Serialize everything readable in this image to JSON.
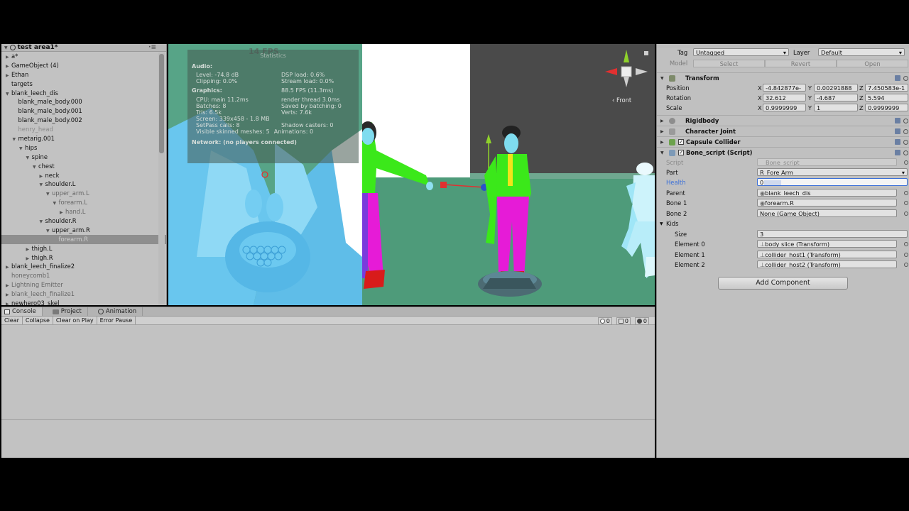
{
  "hierarchy": {
    "scene_name": "test area1*",
    "menu": "·≡",
    "items": [
      {
        "label": "a*",
        "depth": 0,
        "expander": "right",
        "style": "normal"
      },
      {
        "label": "GameObject (4)",
        "depth": 0,
        "expander": "right",
        "style": "normal"
      },
      {
        "label": "Ethan",
        "depth": 0,
        "expander": "right",
        "style": "normal"
      },
      {
        "label": "targets",
        "depth": 0,
        "expander": "",
        "style": "normal"
      },
      {
        "label": "blank_leech_dis",
        "depth": 0,
        "expander": "down",
        "style": "normal"
      },
      {
        "label": "blank_male_body.000",
        "depth": 1,
        "expander": "",
        "style": "normal"
      },
      {
        "label": "blank_male_body.001",
        "depth": 1,
        "expander": "",
        "style": "normal"
      },
      {
        "label": "blank_male_body.002",
        "depth": 1,
        "expander": "",
        "style": "normal"
      },
      {
        "label": "henry_head",
        "depth": 1,
        "expander": "",
        "style": "lfaded"
      },
      {
        "label": "metarig.001",
        "depth": 1,
        "expander": "down",
        "style": "normal"
      },
      {
        "label": "hips",
        "depth": 2,
        "expander": "down",
        "style": "normal"
      },
      {
        "label": "spine",
        "depth": 3,
        "expander": "down",
        "style": "normal"
      },
      {
        "label": "chest",
        "depth": 4,
        "expander": "down",
        "style": "normal"
      },
      {
        "label": "neck",
        "depth": 5,
        "expander": "right",
        "style": "normal"
      },
      {
        "label": "shoulder.L",
        "depth": 5,
        "expander": "down",
        "style": "normal"
      },
      {
        "label": "upper_arm.L",
        "depth": 6,
        "expander": "down",
        "style": "faded"
      },
      {
        "label": "forearm.L",
        "depth": 7,
        "expander": "down",
        "style": "faded"
      },
      {
        "label": "hand.L",
        "depth": 8,
        "expander": "right",
        "style": "faded"
      },
      {
        "label": "shoulder.R",
        "depth": 5,
        "expander": "down",
        "style": "normal"
      },
      {
        "label": "upper_arm.R",
        "depth": 6,
        "expander": "down",
        "style": "normal"
      },
      {
        "label": "forearm.R",
        "depth": 7,
        "expander": "",
        "style": "selected"
      },
      {
        "label": "thigh.L",
        "depth": 3,
        "expander": "right",
        "style": "normal"
      },
      {
        "label": "thigh.R",
        "depth": 3,
        "expander": "right",
        "style": "normal"
      },
      {
        "label": "blank_leech_finalize2",
        "depth": 0,
        "expander": "right",
        "style": "normal"
      },
      {
        "label": "honeycomb1",
        "depth": 0,
        "expander": "",
        "style": "faded"
      },
      {
        "label": "Lightning Emitter",
        "depth": 0,
        "expander": "right",
        "style": "faded"
      },
      {
        "label": "blank_leech_finalize1",
        "depth": 0,
        "expander": "right",
        "style": "faded"
      },
      {
        "label": "newhero03_skel",
        "depth": 0,
        "expander": "right",
        "style": "normal"
      }
    ]
  },
  "game_view": {
    "fps_overlay": "14 FPS",
    "stats": {
      "title": "Statistics",
      "audio_header": "Audio:",
      "level": "Level: -74.8 dB",
      "dsp_load": "DSP load: 0.6%",
      "clipping": "Clipping: 0.0%",
      "stream_load": "Stream load: 0.0%",
      "graphics_header": "Graphics:",
      "graphics_fps": "88.5 FPS (11.3ms)",
      "cpu": "CPU: main 11.2ms",
      "render_thread": "render thread 3.0ms",
      "batches": "Batches: 8",
      "saved_batching": "Saved by batching: 0",
      "tris": "Tris: 6.5k",
      "verts": "Verts: 7.6k",
      "screen": "Screen: 339x458 - 1.8 MB",
      "setpass": "SetPass calls: 8",
      "shadow_casters": "Shadow casters: 0",
      "skinned": "Visible skinned meshes: 5",
      "animations": "Animations: 0",
      "network": "Network: (no players connected)"
    }
  },
  "scene_view": {
    "gizmo_label": "‹ Front"
  },
  "console": {
    "tabs": [
      "Console",
      "Project",
      "Animation"
    ],
    "toolbar": [
      "Clear",
      "Collapse",
      "Clear on Play",
      "Error Pause"
    ],
    "counts": {
      "info": "0",
      "warning": "0",
      "error": "0"
    }
  },
  "inspector": {
    "tag_label": "Tag",
    "tag_value": "Untagged",
    "layer_label": "Layer",
    "layer_value": "Default",
    "model_label": "Model",
    "select": "Select",
    "revert": "Revert",
    "open": "Open",
    "transform": {
      "title": "Transform",
      "position_label": "Position",
      "position": {
        "x": "-4.842877e-",
        "y": "0.00291888",
        "z": "7.450583e-1"
      },
      "rotation_label": "Rotation",
      "rotation": {
        "x": "32.612",
        "y": "-4.687",
        "z": "5.594"
      },
      "scale_label": "Scale",
      "scale": {
        "x": "0.9999999",
        "y": "1",
        "z": "0.9999999"
      }
    },
    "rigidbody": "Rigidbody",
    "character_joint": "Character Joint",
    "capsule_collider": "Capsule Collider",
    "bone_script": {
      "title": "Bone_script (Script)",
      "script_label": "Script",
      "script_value": "Bone_script",
      "part_label": "Part",
      "part_value": "R_Fore Arm",
      "health_label": "Health",
      "health_value": "0",
      "parent_label": "Parent",
      "parent_value": "blank_leech_dis",
      "bone1_label": "Bone 1",
      "bone1_value": "forearm.R",
      "bone2_label": "Bone 2",
      "bone2_value": "None (Game Object)",
      "kids_label": "Kids",
      "size_label": "Size",
      "size_value": "3",
      "element0_label": "Element 0",
      "element0_value": "body slice (Transform)",
      "element1_label": "Element 1",
      "element1_value": "collider_host1 (Transform)",
      "element2_label": "Element 2",
      "element2_value": "collider_host2 (Transform)"
    },
    "add_component": "Add Component"
  },
  "colors": {
    "editor_bg": "#c2c2c2",
    "scene_green": "#4f9c7b",
    "highlight_blue": "#3a6fd8"
  }
}
